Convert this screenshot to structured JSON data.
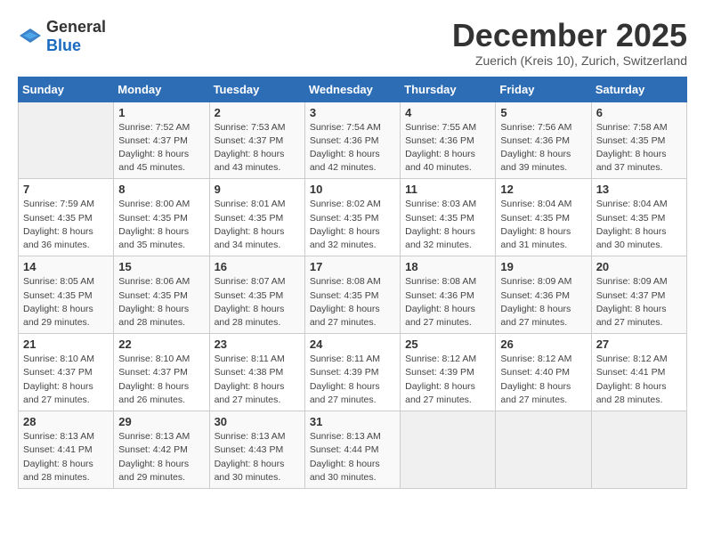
{
  "header": {
    "logo_general": "General",
    "logo_blue": "Blue",
    "month_title": "December 2025",
    "location": "Zuerich (Kreis 10), Zurich, Switzerland"
  },
  "weekdays": [
    "Sunday",
    "Monday",
    "Tuesday",
    "Wednesday",
    "Thursday",
    "Friday",
    "Saturday"
  ],
  "weeks": [
    [
      {
        "day": "",
        "info": ""
      },
      {
        "day": "1",
        "info": "Sunrise: 7:52 AM\nSunset: 4:37 PM\nDaylight: 8 hours\nand 45 minutes."
      },
      {
        "day": "2",
        "info": "Sunrise: 7:53 AM\nSunset: 4:37 PM\nDaylight: 8 hours\nand 43 minutes."
      },
      {
        "day": "3",
        "info": "Sunrise: 7:54 AM\nSunset: 4:36 PM\nDaylight: 8 hours\nand 42 minutes."
      },
      {
        "day": "4",
        "info": "Sunrise: 7:55 AM\nSunset: 4:36 PM\nDaylight: 8 hours\nand 40 minutes."
      },
      {
        "day": "5",
        "info": "Sunrise: 7:56 AM\nSunset: 4:36 PM\nDaylight: 8 hours\nand 39 minutes."
      },
      {
        "day": "6",
        "info": "Sunrise: 7:58 AM\nSunset: 4:35 PM\nDaylight: 8 hours\nand 37 minutes."
      }
    ],
    [
      {
        "day": "7",
        "info": "Sunrise: 7:59 AM\nSunset: 4:35 PM\nDaylight: 8 hours\nand 36 minutes."
      },
      {
        "day": "8",
        "info": "Sunrise: 8:00 AM\nSunset: 4:35 PM\nDaylight: 8 hours\nand 35 minutes."
      },
      {
        "day": "9",
        "info": "Sunrise: 8:01 AM\nSunset: 4:35 PM\nDaylight: 8 hours\nand 34 minutes."
      },
      {
        "day": "10",
        "info": "Sunrise: 8:02 AM\nSunset: 4:35 PM\nDaylight: 8 hours\nand 32 minutes."
      },
      {
        "day": "11",
        "info": "Sunrise: 8:03 AM\nSunset: 4:35 PM\nDaylight: 8 hours\nand 32 minutes."
      },
      {
        "day": "12",
        "info": "Sunrise: 8:04 AM\nSunset: 4:35 PM\nDaylight: 8 hours\nand 31 minutes."
      },
      {
        "day": "13",
        "info": "Sunrise: 8:04 AM\nSunset: 4:35 PM\nDaylight: 8 hours\nand 30 minutes."
      }
    ],
    [
      {
        "day": "14",
        "info": "Sunrise: 8:05 AM\nSunset: 4:35 PM\nDaylight: 8 hours\nand 29 minutes."
      },
      {
        "day": "15",
        "info": "Sunrise: 8:06 AM\nSunset: 4:35 PM\nDaylight: 8 hours\nand 28 minutes."
      },
      {
        "day": "16",
        "info": "Sunrise: 8:07 AM\nSunset: 4:35 PM\nDaylight: 8 hours\nand 28 minutes."
      },
      {
        "day": "17",
        "info": "Sunrise: 8:08 AM\nSunset: 4:35 PM\nDaylight: 8 hours\nand 27 minutes."
      },
      {
        "day": "18",
        "info": "Sunrise: 8:08 AM\nSunset: 4:36 PM\nDaylight: 8 hours\nand 27 minutes."
      },
      {
        "day": "19",
        "info": "Sunrise: 8:09 AM\nSunset: 4:36 PM\nDaylight: 8 hours\nand 27 minutes."
      },
      {
        "day": "20",
        "info": "Sunrise: 8:09 AM\nSunset: 4:37 PM\nDaylight: 8 hours\nand 27 minutes."
      }
    ],
    [
      {
        "day": "21",
        "info": "Sunrise: 8:10 AM\nSunset: 4:37 PM\nDaylight: 8 hours\nand 27 minutes."
      },
      {
        "day": "22",
        "info": "Sunrise: 8:10 AM\nSunset: 4:37 PM\nDaylight: 8 hours\nand 26 minutes."
      },
      {
        "day": "23",
        "info": "Sunrise: 8:11 AM\nSunset: 4:38 PM\nDaylight: 8 hours\nand 27 minutes."
      },
      {
        "day": "24",
        "info": "Sunrise: 8:11 AM\nSunset: 4:39 PM\nDaylight: 8 hours\nand 27 minutes."
      },
      {
        "day": "25",
        "info": "Sunrise: 8:12 AM\nSunset: 4:39 PM\nDaylight: 8 hours\nand 27 minutes."
      },
      {
        "day": "26",
        "info": "Sunrise: 8:12 AM\nSunset: 4:40 PM\nDaylight: 8 hours\nand 27 minutes."
      },
      {
        "day": "27",
        "info": "Sunrise: 8:12 AM\nSunset: 4:41 PM\nDaylight: 8 hours\nand 28 minutes."
      }
    ],
    [
      {
        "day": "28",
        "info": "Sunrise: 8:13 AM\nSunset: 4:41 PM\nDaylight: 8 hours\nand 28 minutes."
      },
      {
        "day": "29",
        "info": "Sunrise: 8:13 AM\nSunset: 4:42 PM\nDaylight: 8 hours\nand 29 minutes."
      },
      {
        "day": "30",
        "info": "Sunrise: 8:13 AM\nSunset: 4:43 PM\nDaylight: 8 hours\nand 30 minutes."
      },
      {
        "day": "31",
        "info": "Sunrise: 8:13 AM\nSunset: 4:44 PM\nDaylight: 8 hours\nand 30 minutes."
      },
      {
        "day": "",
        "info": ""
      },
      {
        "day": "",
        "info": ""
      },
      {
        "day": "",
        "info": ""
      }
    ]
  ]
}
